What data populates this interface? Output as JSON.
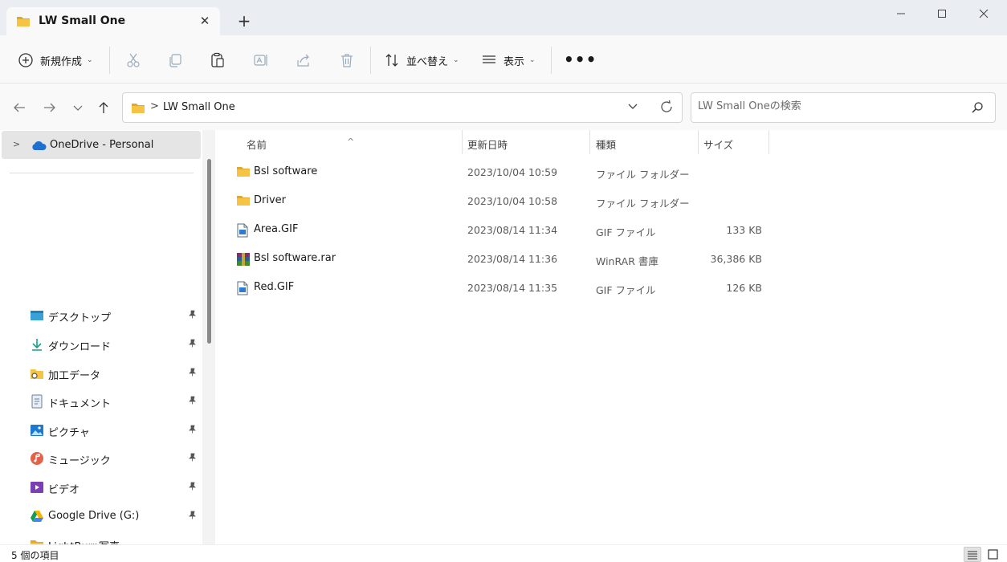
{
  "window": {
    "tab_title": "LW Small One",
    "tab_close": "✕",
    "new_tab": "+",
    "minimize": "—",
    "maximize": "☐",
    "close": "✕"
  },
  "toolbar": {
    "new_label": "新規作成",
    "sort_label": "並べ替え",
    "view_label": "表示",
    "more_label": "•••",
    "chevron": "⌄"
  },
  "address": {
    "crumb_separator": ">",
    "path": "LW Small One",
    "search_placeholder": "LW Small Oneの検索"
  },
  "sidebar": {
    "expand": ">",
    "onedrive_label": "OneDrive - Personal",
    "items": [
      {
        "label": "デスクトップ",
        "icon": "desktop-icon"
      },
      {
        "label": "ダウンロード",
        "icon": "download-icon"
      },
      {
        "label": "加工データ",
        "icon": "folder-shared-icon"
      },
      {
        "label": "ドキュメント",
        "icon": "document-icon"
      },
      {
        "label": "ピクチャ",
        "icon": "pictures-icon"
      },
      {
        "label": "ミュージック",
        "icon": "music-icon"
      },
      {
        "label": "ビデオ",
        "icon": "video-icon"
      },
      {
        "label": "Google Drive (G:)",
        "icon": "google-drive-icon"
      },
      {
        "label": "LightBurn写真",
        "icon": "folder-icon"
      }
    ],
    "pin_glyph": "📌"
  },
  "columns": {
    "name": "名前",
    "date": "更新日時",
    "type": "種類",
    "size": "サイズ",
    "sort_caret": "^"
  },
  "files": [
    {
      "name": "Bsl software",
      "date": "2023/10/04 10:59",
      "type": "ファイル フォルダー",
      "size": "",
      "icon": "folder-icon"
    },
    {
      "name": "Driver",
      "date": "2023/10/04 10:58",
      "type": "ファイル フォルダー",
      "size": "",
      "icon": "folder-icon"
    },
    {
      "name": "Area.GIF",
      "date": "2023/08/14 11:34",
      "type": "GIF ファイル",
      "size": "133 KB",
      "icon": "gif-file-icon"
    },
    {
      "name": "Bsl software.rar",
      "date": "2023/08/14 11:36",
      "type": "WinRAR 書庫",
      "size": "36,386 KB",
      "icon": "winrar-icon"
    },
    {
      "name": "Red.GIF",
      "date": "2023/08/14 11:35",
      "type": "GIF ファイル",
      "size": "126 KB",
      "icon": "gif-file-icon"
    }
  ],
  "status": {
    "count_text": "5 個の項目"
  },
  "colors": {
    "folder": "#f6c445",
    "folder_dark": "#e0a82e",
    "onedrive": "#1f6fd1",
    "accent": "#005fb8"
  }
}
